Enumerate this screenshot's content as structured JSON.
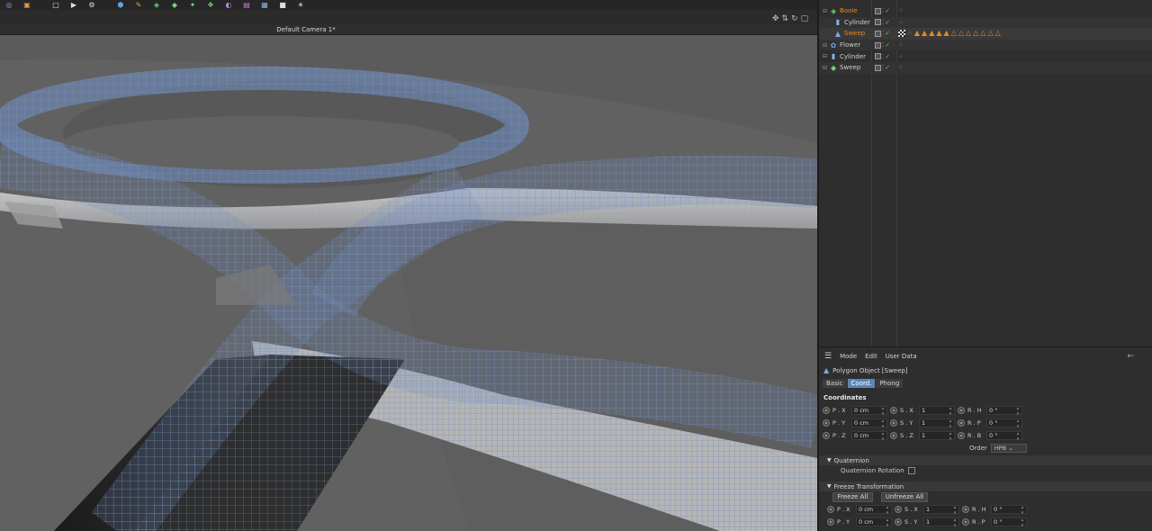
{
  "toolbar": {
    "icons": [
      "render-settings-icon",
      "render-icon",
      "new-doc-icon",
      "play-icon",
      "settings-icon",
      "cube-icon",
      "pen-icon",
      "subdivision-icon",
      "generator-icon",
      "deformer-icon",
      "array-icon",
      "spline-icon",
      "effector-icon",
      "floor-icon",
      "camera-icon",
      "light-icon"
    ]
  },
  "viewport": {
    "title": "Default Camera 1*"
  },
  "object_manager": {
    "rows": [
      {
        "name": "Boole",
        "icon": "boole-icon",
        "indent": 1,
        "color": "#e08a2c",
        "tags": []
      },
      {
        "name": "Cylinder",
        "icon": "cylinder-icon",
        "indent": 2,
        "color": "#cfcfcf",
        "tags": []
      },
      {
        "name": "Sweep",
        "icon": "polygon-icon",
        "indent": 2,
        "color": "#e08a2c",
        "tags": [
          "texture",
          "dots",
          "tri",
          "tri",
          "tri",
          "tri",
          "tri",
          "tri-o",
          "tri-o",
          "tri-o",
          "tri-o",
          "tri-o",
          "tri-o",
          "tri-o"
        ]
      },
      {
        "name": "Flower",
        "icon": "flower-icon",
        "indent": 1,
        "color": "#cfcfcf",
        "tags": []
      },
      {
        "name": "Cylinder",
        "icon": "cylinder-icon",
        "indent": 1,
        "color": "#cfcfcf",
        "tags": []
      },
      {
        "name": "Sweep",
        "icon": "sweep-icon",
        "indent": 1,
        "color": "#cfcfcf",
        "tags": []
      }
    ]
  },
  "attributes": {
    "menu": [
      "Mode",
      "Edit",
      "User Data"
    ],
    "object_title": "Polygon Object [Sweep]",
    "tabs": [
      "Basic",
      "Coord.",
      "Phong"
    ],
    "active_tab": "Coord.",
    "coordinates_title": "Coordinates",
    "coords": [
      [
        {
          "label": "P . X",
          "value": "0 cm"
        },
        {
          "label": "S . X",
          "value": "1"
        },
        {
          "label": "R . H",
          "value": "0 °"
        }
      ],
      [
        {
          "label": "P . Y",
          "value": "0 cm"
        },
        {
          "label": "S . Y",
          "value": "1"
        },
        {
          "label": "R . P",
          "value": "0 °"
        }
      ],
      [
        {
          "label": "P . Z",
          "value": "0 cm"
        },
        {
          "label": "S . Z",
          "value": "1"
        },
        {
          "label": "R . B",
          "value": "0 °"
        }
      ]
    ],
    "order_label": "Order",
    "order_value": "HPB",
    "quaternion_title": "Quaternion",
    "quaternion_rotation_label": "Quaternion Rotation",
    "freeze_title": "Freeze Transformation",
    "freeze_all": "Freeze All",
    "unfreeze_all": "Unfreeze All",
    "freeze_coords": [
      [
        {
          "label": "P . X",
          "value": "0 cm"
        },
        {
          "label": "S . X",
          "value": "1"
        },
        {
          "label": "R . H",
          "value": "0 °"
        }
      ],
      [
        {
          "label": "P . Y",
          "value": "0 cm"
        },
        {
          "label": "S . Y",
          "value": "1"
        },
        {
          "label": "R . P",
          "value": "0 °"
        }
      ]
    ]
  },
  "colors": {
    "accent": "#5c86bb",
    "active_object": "#e08a2c",
    "wire": "#6e8fc4"
  }
}
